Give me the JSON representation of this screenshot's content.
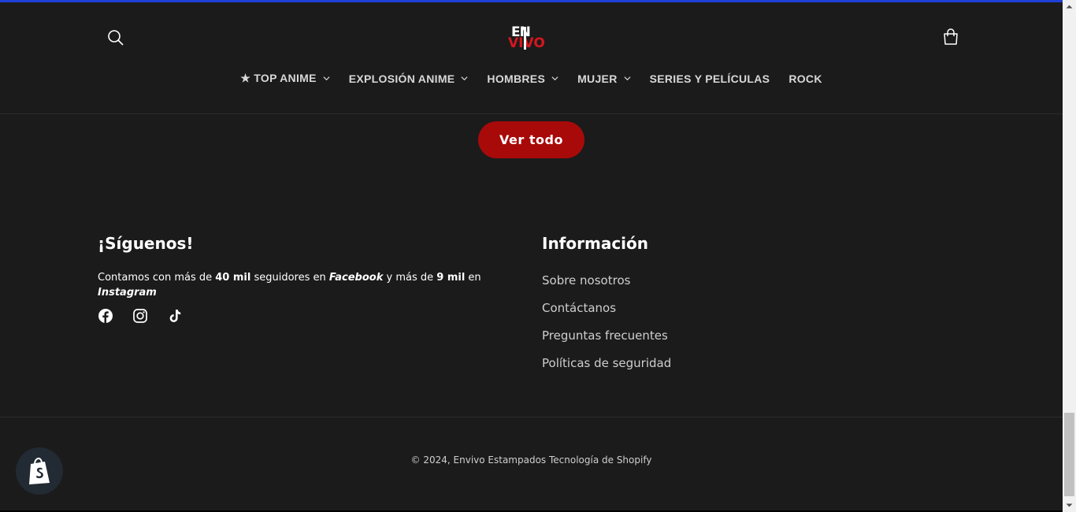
{
  "header": {
    "logo_top": "EN",
    "logo_bottom": "VIVO",
    "nav": [
      {
        "label": "★ TOP ANIME",
        "dropdown": true
      },
      {
        "label": "EXPLOSIÓN ANIME",
        "dropdown": true
      },
      {
        "label": "HOMBRES",
        "dropdown": true
      },
      {
        "label": "MUJER",
        "dropdown": true
      },
      {
        "label": "SERIES Y PELÍCULAS",
        "dropdown": false
      },
      {
        "label": "ROCK",
        "dropdown": false
      }
    ]
  },
  "main": {
    "view_all_label": "Ver todo"
  },
  "footer": {
    "follow": {
      "title": "¡Síguenos!",
      "text_1": "Contamos con más de ",
      "bold_1": "40 mil",
      "text_2": " seguidores en ",
      "italic_1": "Facebook",
      "text_3": " y más de ",
      "bold_2": "9 mil",
      "text_4": " en ",
      "italic_2": "Instagram"
    },
    "info": {
      "title": "Información",
      "links": [
        "Sobre nosotros",
        "Contáctanos",
        "Preguntas frecuentes",
        "Políticas de seguridad"
      ]
    },
    "copyright": "© 2024, Envivo Estampados Tecnología de Shopify"
  },
  "colors": {
    "background": "#1b1b1b",
    "accent_red": "#a80a0a",
    "top_line": "#1f3fd6"
  },
  "icons": {
    "search": "search-icon",
    "cart": "cart-icon",
    "facebook": "facebook-icon",
    "instagram": "instagram-icon",
    "tiktok": "tiktok-icon",
    "shopify": "shopify-icon"
  }
}
